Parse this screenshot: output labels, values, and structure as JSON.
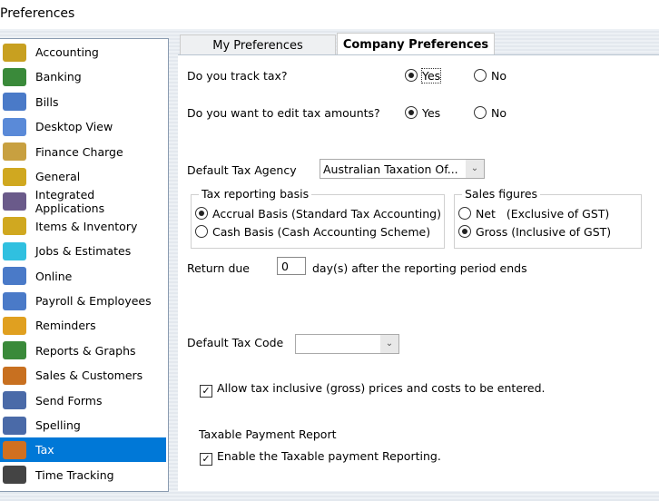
{
  "window": {
    "title": "Preferences"
  },
  "sidebar": {
    "items": [
      {
        "label": "Accounting",
        "icon": "accounting-icon",
        "color": "#c8a020"
      },
      {
        "label": "Banking",
        "icon": "banking-icon",
        "color": "#3a8a3a"
      },
      {
        "label": "Bills",
        "icon": "bills-icon",
        "color": "#4a7ac8"
      },
      {
        "label": "Desktop View",
        "icon": "desktop-view-icon",
        "color": "#5a8ad8"
      },
      {
        "label": "Finance Charge",
        "icon": "finance-charge-icon",
        "color": "#c8a040"
      },
      {
        "label": "General",
        "icon": "general-icon",
        "color": "#d0a820"
      },
      {
        "label": "Integrated Applications",
        "icon": "integrated-applications-icon",
        "color": "#6a5a8a"
      },
      {
        "label": "Items & Inventory",
        "icon": "items-inventory-icon",
        "color": "#d0a820"
      },
      {
        "label": "Jobs & Estimates",
        "icon": "jobs-estimates-icon",
        "color": "#30c0e0"
      },
      {
        "label": "Online",
        "icon": "online-icon",
        "color": "#4a7ac8"
      },
      {
        "label": "Payroll & Employees",
        "icon": "payroll-employees-icon",
        "color": "#4a7ac8"
      },
      {
        "label": "Reminders",
        "icon": "reminders-icon",
        "color": "#e0a020"
      },
      {
        "label": "Reports & Graphs",
        "icon": "reports-graphs-icon",
        "color": "#3a8a3a"
      },
      {
        "label": "Sales & Customers",
        "icon": "sales-customers-icon",
        "color": "#c87020"
      },
      {
        "label": "Send Forms",
        "icon": "send-forms-icon",
        "color": "#4a6aa8"
      },
      {
        "label": "Spelling",
        "icon": "spelling-icon",
        "color": "#4a6aa8"
      },
      {
        "label": "Tax",
        "icon": "tax-icon",
        "color": "#d07020"
      },
      {
        "label": "Time Tracking",
        "icon": "time-tracking-icon",
        "color": "#444444"
      }
    ],
    "selected": "Tax"
  },
  "tabs": {
    "my": "My Preferences",
    "company": "Company Preferences"
  },
  "form": {
    "track_tax": {
      "label": "Do you track tax?",
      "yes": "Yes",
      "no": "No"
    },
    "edit_tax": {
      "label": "Do you want to edit tax amounts?",
      "yes": "Yes",
      "no": "No"
    },
    "agency": {
      "label": "Default Tax Agency",
      "value": "Australian Taxation Of..."
    },
    "basis": {
      "legend": "Tax reporting basis",
      "accrual": "Accrual Basis (Standard Tax Accounting)",
      "cash": "Cash Basis (Cash Accounting Scheme)"
    },
    "sales": {
      "legend": "Sales figures",
      "net": "Net   (Exclusive of GST)",
      "gross": "Gross (Inclusive of GST)"
    },
    "return_due": {
      "label": "Return due",
      "value": "0",
      "suffix": "day(s) after the reporting period ends"
    },
    "tax_code": {
      "label": "Default Tax Code",
      "value": ""
    },
    "allow_inclusive": "Allow tax inclusive (gross) prices and costs to be entered.",
    "tpr": {
      "heading": "Taxable Payment Report",
      "enable": "Enable the Taxable payment Reporting."
    }
  }
}
